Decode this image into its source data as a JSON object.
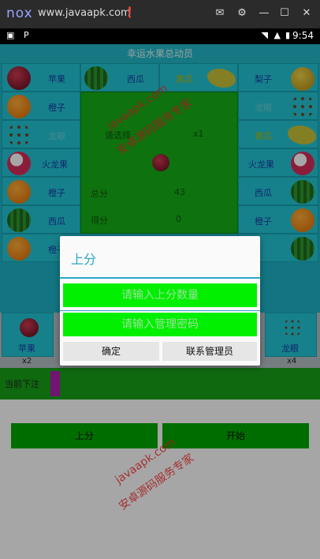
{
  "emulator": {
    "logo": "nox",
    "site": "www.javaapk.com"
  },
  "status": {
    "time": "9:54"
  },
  "app": {
    "title": "幸运水果总动员"
  },
  "board": {
    "top_row": [
      {
        "label": "苹果"
      },
      {
        "label": "西瓜"
      },
      {
        "label": "黄瓜"
      },
      {
        "label": "梨子"
      }
    ],
    "left_col": [
      {
        "label": "橙子"
      },
      {
        "label": "龙眼"
      },
      {
        "label": "火龙果"
      },
      {
        "label": "橙子"
      },
      {
        "label": "西瓜"
      },
      {
        "label": "橙子"
      }
    ],
    "right_col": [
      {
        "label": "龙眼"
      },
      {
        "label": "黄瓜"
      },
      {
        "label": "火龙果"
      },
      {
        "label": "西瓜"
      },
      {
        "label": "橙子"
      }
    ],
    "center": {
      "line1_label": "请选择",
      "line1_mult": "x1",
      "total_label": "总分",
      "total_value": "43",
      "win_label": "得分",
      "win_value": "0"
    }
  },
  "bottom": {
    "cells": [
      {
        "label": "苹果"
      },
      {
        "label": "龙眼"
      }
    ],
    "multipliers": [
      "x2",
      "x4"
    ]
  },
  "bet": {
    "label": "当前下注"
  },
  "actions": {
    "add_score": "上分",
    "start": "开始"
  },
  "dialog": {
    "title": "上分",
    "amount_placeholder": "请输入上分数量",
    "password_placeholder": "请输入管理密码",
    "confirm": "确定",
    "contact": "联系管理员"
  },
  "watermarks": [
    "javaapk.com",
    "安卓源码服务专家"
  ],
  "colors": {
    "primary_teal": "#22b8c9",
    "green": "#00a800",
    "dialog_accent": "#2aa6c8"
  }
}
